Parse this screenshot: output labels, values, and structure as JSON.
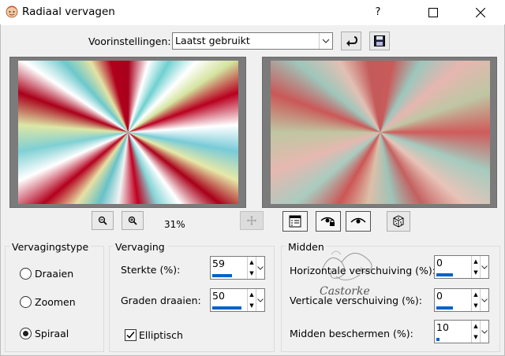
{
  "window": {
    "title": "Radiaal vervagen",
    "help_label": "?"
  },
  "presets": {
    "label": "Voorinstellingen:",
    "value": "Laatst gebruikt"
  },
  "zoom": {
    "level": "31%"
  },
  "fade_type": {
    "title": "Vervagingstype",
    "options": [
      {
        "label": "Draaien",
        "selected": false
      },
      {
        "label": "Zoomen",
        "selected": false
      },
      {
        "label": "Spiraal",
        "selected": true
      }
    ]
  },
  "vervaging": {
    "title": "Vervaging",
    "sterkte": {
      "label": "Sterkte (%):",
      "value": "59",
      "fraction": 0.59
    },
    "graden": {
      "label": "Graden draaien:",
      "value": "50",
      "fraction": 0.88
    },
    "elliptisch": {
      "label": "Elliptisch",
      "checked": true
    }
  },
  "midden": {
    "title": "Midden",
    "horizontaal": {
      "label": "Horizontale verschuiving (%):",
      "value": "0",
      "fraction": 0.5
    },
    "verticaal": {
      "label": "Verticale verschuiving (%):",
      "value": "0",
      "fraction": 0.5
    },
    "beschermen": {
      "label": "Midden beschermen (%):",
      "value": "10",
      "fraction": 0.1
    }
  },
  "watermark": {
    "text": "Castorke"
  },
  "colors": {
    "accent": "#0063c9"
  }
}
